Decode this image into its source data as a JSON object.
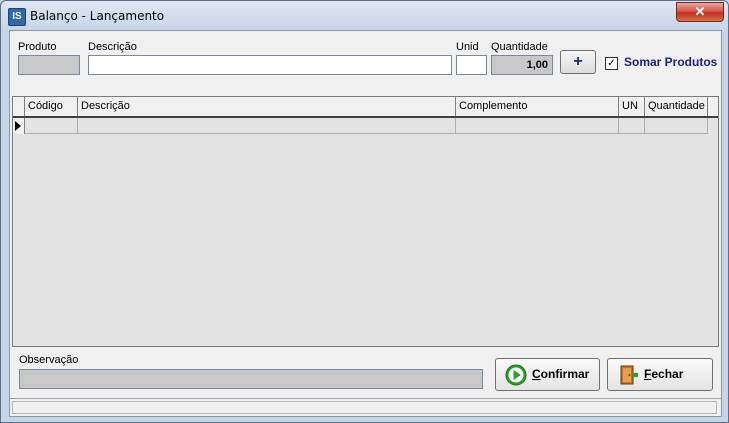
{
  "window": {
    "title": "Balanço - Lançamento",
    "app_icon": "IS",
    "close_label": "✕"
  },
  "form": {
    "produto_label": "Produto",
    "descricao_label": "Descrição",
    "unid_label": "Unid",
    "quantidade_label": "Quantidade",
    "quantidade_value": "1,00",
    "add_button": "+",
    "somar_checked": true,
    "somar_label": "Somar Produtos"
  },
  "grid": {
    "columns": [
      "Código",
      "Descrição",
      "Complemento",
      "UN",
      "Quantidade"
    ]
  },
  "footer": {
    "observacao_label": "Observação",
    "confirm_prefix": "C",
    "confirm_rest": "onfirmar",
    "close_prefix": "F",
    "close_rest": "echar"
  },
  "colors": {
    "accent_text": "#1a237e",
    "confirm_icon": "#2aa12a",
    "close_icon": "#c87020"
  },
  "icons": {
    "confirm": "play-arrow-icon",
    "close": "door-exit-icon",
    "checkbox": "checkmark-icon"
  }
}
